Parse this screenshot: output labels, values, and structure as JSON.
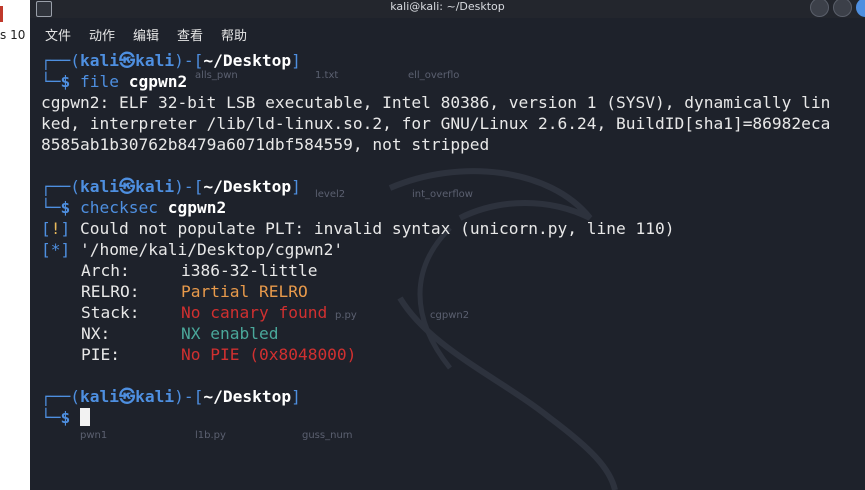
{
  "left_fragment": "s 10",
  "window": {
    "title": "kali@kali: ~/Desktop",
    "menu": [
      "文件",
      "动作",
      "编辑",
      "查看",
      "帮助"
    ]
  },
  "desktop_labels": [
    "alls_pwn",
    "1.txt",
    "ell_overflo",
    "level2",
    "int_overflow",
    "p.py",
    "cgpwn2",
    "pwn1",
    "l1b.py",
    "guss_num"
  ],
  "prompt": {
    "corner_top": "┌──(",
    "user": "kali",
    "at": "㉿",
    "host": "kali",
    "close_mid": ")-[",
    "path": "~/Desktop",
    "close": "]",
    "corner_bottom": "└─",
    "dollar": "$"
  },
  "commands": [
    {
      "name": "file",
      "arg": "cgpwn2"
    },
    {
      "name": "checksec",
      "arg": "cgpwn2"
    }
  ],
  "file_output": [
    "cgpwn2: ELF 32-bit LSB executable, Intel 80386, version 1 (SYSV), dynamically lin",
    "ked, interpreter /lib/ld-linux.so.2, for GNU/Linux 2.6.24, BuildID[sha1]=86982eca",
    "8585ab1b30762b8479a6071dbf584559, not stripped"
  ],
  "checksec": {
    "warn_open": "[",
    "warn_mark": "!",
    "warn_close": "]",
    "warn_text": " Could not populate PLT: invalid syntax (unicorn.py, line 110)",
    "info_open": "[",
    "info_mark": "*",
    "info_close": "]",
    "info_text": " '/home/kali/Desktop/cgpwn2'",
    "rows": [
      {
        "key": "Arch:",
        "value": "i386-32-little"
      },
      {
        "key": "RELRO:",
        "value": "Partial RELRO"
      },
      {
        "key": "Stack:",
        "value": "No canary found"
      },
      {
        "key": "NX:",
        "value": "NX enabled"
      },
      {
        "key": "PIE:",
        "value": "No PIE (0x8048000)"
      }
    ]
  },
  "colors": {
    "background": "#1e222b",
    "prompt_blue": "#4e8fe0",
    "warn_yellow": "#e8b95a",
    "partial_orange": "#e89a4b",
    "bad_red": "#d03030",
    "good_teal": "#4aa79a"
  }
}
